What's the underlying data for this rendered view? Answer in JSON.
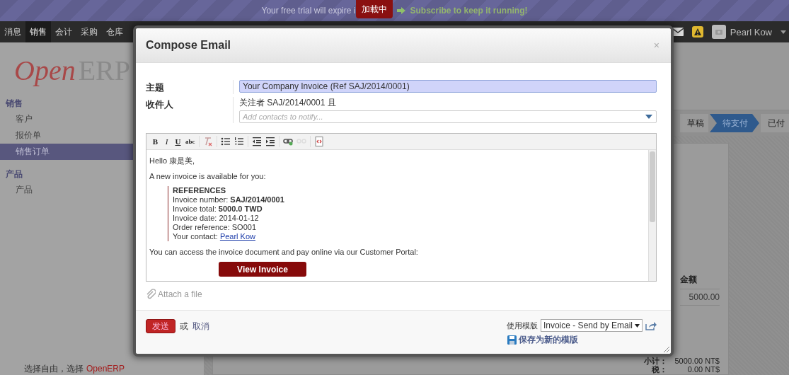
{
  "trial_bar": {
    "text": "Your free trial will expire i",
    "loading_badge": "加載中",
    "subscribe_link": "Subscribe to keep it running!"
  },
  "nav": {
    "menus": [
      {
        "label": "消息",
        "selected": false
      },
      {
        "label": "销售",
        "selected": true
      },
      {
        "label": "会计",
        "selected": false
      },
      {
        "label": "采购",
        "selected": false
      },
      {
        "label": "仓库",
        "selected": false
      }
    ],
    "user": "Pearl Kow"
  },
  "sidebar": {
    "logo": {
      "first": "Open",
      "second": "ERP"
    },
    "sections": [
      {
        "title": "销售",
        "items": [
          {
            "label": "客户",
            "selected": false
          },
          {
            "label": "报价单",
            "selected": false
          },
          {
            "label": "销售订单",
            "selected": true
          }
        ]
      },
      {
        "title": "产品",
        "items": [
          {
            "label": "产品",
            "selected": false
          }
        ]
      }
    ],
    "footer": {
      "text": "选择自由，选择",
      "brand": "OpenERP"
    }
  },
  "record": {
    "steps": [
      {
        "label": "草稿",
        "selected": false
      },
      {
        "label": "待支付",
        "selected": true
      },
      {
        "label": "已付",
        "selected": false
      }
    ],
    "column": "金额",
    "amount": "5000.00",
    "totals": [
      {
        "label": "小计：",
        "value": "5000.00 NT$"
      },
      {
        "label": "税：",
        "value": "0.00 NT$"
      }
    ]
  },
  "dialog": {
    "title": "Compose Email",
    "close": "×",
    "subject_label": "主题",
    "subject": "Your Company Invoice (Ref SAJ/2014/0001)",
    "recipients_label": "收件人",
    "followers": "关注者 SAJ/2014/0001 且",
    "contacts_placeholder": "Add contacts to notify...",
    "toolbar": [
      {
        "kind": "bold",
        "label": "B",
        "disabled": false
      },
      {
        "kind": "italic",
        "label": "I",
        "disabled": false
      },
      {
        "kind": "underline",
        "label": "U",
        "disabled": false
      },
      {
        "kind": "strike",
        "label": "abc",
        "disabled": false
      },
      {
        "kind": "clear",
        "disabled": false
      },
      {
        "kind": "bullets",
        "disabled": false
      },
      {
        "kind": "numbers",
        "disabled": false
      },
      {
        "kind": "outdent",
        "disabled": false
      },
      {
        "kind": "indent",
        "disabled": false
      },
      {
        "kind": "link",
        "disabled": false
      },
      {
        "kind": "unlink",
        "disabled": true
      },
      {
        "kind": "source",
        "disabled": false
      }
    ],
    "body": {
      "greeting": "Hello 康是美,",
      "intro": "A new invoice is available for you:",
      "ref_title": "REFERENCES",
      "lines": [
        "Invoice number: **SAJ/2014/0001**",
        "Invoice total: **5000.0 TWD**",
        "Invoice date: 2014-01-12",
        "Order reference: SO001"
      ],
      "contact_label": "Your contact:",
      "contact_link": "Pearl Kow",
      "portal": "You can access the invoice document and pay online via our Customer Portal:",
      "button": "View Invoice"
    },
    "attach": "Attach a file",
    "send": "发送",
    "or": "或",
    "cancel": "取消",
    "template_label": "使用模版",
    "template": "Invoice - Send by Email",
    "save_template": "保存为新的模版"
  }
}
